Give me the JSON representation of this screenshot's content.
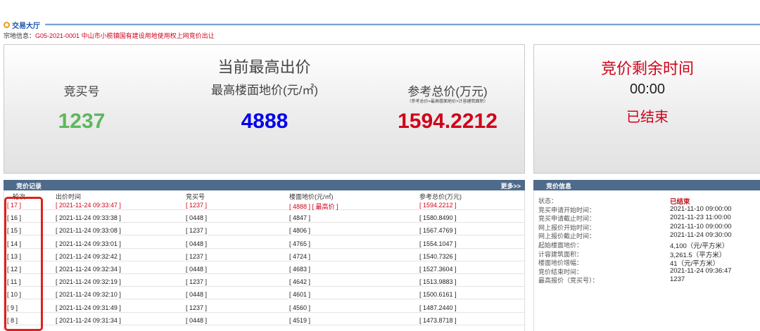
{
  "header": {
    "hall_title": "交易大厅",
    "parcel_label": "宗地信息：",
    "parcel_value": "G05-2021-0001 中山市小榄镇国有建设用地使用权上网竞价出让"
  },
  "highest_bid": {
    "title": "当前最高出价",
    "bidder_label": "竞买号",
    "bidder_value": "1237",
    "floor_price_label": "最高楼面地价(元/㎡)",
    "floor_price_value": "4888",
    "total_label": "参考总价(万元)",
    "total_note": "（参考总价=最高楼面地价×计容建筑面积）",
    "total_value": "1594.2212"
  },
  "timer": {
    "title": "竞价剩余时间",
    "time": "00:00",
    "status": "已结束"
  },
  "records": {
    "title": "竞价记录",
    "more": "更多>>",
    "columns": [
      "轮次",
      "出价时间",
      "竞买号",
      "楼面地价(元/㎡)",
      "参考总价(万元)"
    ],
    "rows": [
      {
        "round": "[ 17 ]",
        "time": "[ 2021-11-24 09:33:47 ]",
        "bidder": "[ 1237 ]",
        "price": "[ 4888 ]  [ 最高价 ]",
        "total": "[ 1594.2212 ]"
      },
      {
        "round": "[ 16 ]",
        "time": "[ 2021-11-24 09:33:38 ]",
        "bidder": "[ 0448 ]",
        "price": "[ 4847 ]",
        "total": "[ 1580.8490 ]"
      },
      {
        "round": "[ 15 ]",
        "time": "[ 2021-11-24 09:33:08 ]",
        "bidder": "[ 1237 ]",
        "price": "[ 4806 ]",
        "total": "[ 1567.4769 ]"
      },
      {
        "round": "[ 14 ]",
        "time": "[ 2021-11-24 09:33:01 ]",
        "bidder": "[ 0448 ]",
        "price": "[ 4765 ]",
        "total": "[ 1554.1047 ]"
      },
      {
        "round": "[ 13 ]",
        "time": "[ 2021-11-24 09:32:42 ]",
        "bidder": "[ 1237 ]",
        "price": "[ 4724 ]",
        "total": "[ 1540.7326 ]"
      },
      {
        "round": "[ 12 ]",
        "time": "[ 2021-11-24 09:32:34 ]",
        "bidder": "[ 0448 ]",
        "price": "[ 4683 ]",
        "total": "[ 1527.3604 ]"
      },
      {
        "round": "[ 11 ]",
        "time": "[ 2021-11-24 09:32:19 ]",
        "bidder": "[ 1237 ]",
        "price": "[ 4642 ]",
        "total": "[ 1513.9883 ]"
      },
      {
        "round": "[ 10 ]",
        "time": "[ 2021-11-24 09:32:10 ]",
        "bidder": "[ 0448 ]",
        "price": "[ 4601 ]",
        "total": "[ 1500.6161 ]"
      },
      {
        "round": "[ 9 ]",
        "time": "[ 2021-11-24 09:31:49 ]",
        "bidder": "[ 1237 ]",
        "price": "[ 4560 ]",
        "total": "[ 1487.2440 ]"
      },
      {
        "round": "[ 8 ]",
        "time": "[ 2021-11-24 09:31:34 ]",
        "bidder": "[ 0448 ]",
        "price": "[ 4519 ]",
        "total": "[ 1473.8718 ]"
      }
    ]
  },
  "info": {
    "title": "竞价信息",
    "items": [
      {
        "label": "状态：",
        "value": "已结束"
      },
      {
        "label": "竞买申请开始时间：",
        "value": "2021-11-10 09:00:00"
      },
      {
        "label": "竞买申请截止时间：",
        "value": "2021-11-23 11:00:00"
      },
      {
        "label": "网上报价开始时间：",
        "value": "2021-11-10 09:00:00"
      },
      {
        "label": "网上报价截止时间：",
        "value": "2021-11-24 09:30:00"
      },
      {
        "label": "起始楼面地价：",
        "value": "4,100（元/平方米）"
      },
      {
        "label": "计容建筑面积：",
        "value": "3,261.5（平方米）"
      },
      {
        "label": "楼面地价增幅：",
        "value": "41（元/平方米）"
      },
      {
        "label": "竞价结束时间：",
        "value": "2021-11-24 09:36:47"
      },
      {
        "label": "最高报价（竞买号）：",
        "value": "1237"
      }
    ]
  },
  "colors": {
    "accent_blue": "#1a56b0",
    "header_bar": "#4e6b8b",
    "highlight_red": "#d0021b",
    "bidder_green": "#5cb85c",
    "price_blue": "#0000ee"
  }
}
